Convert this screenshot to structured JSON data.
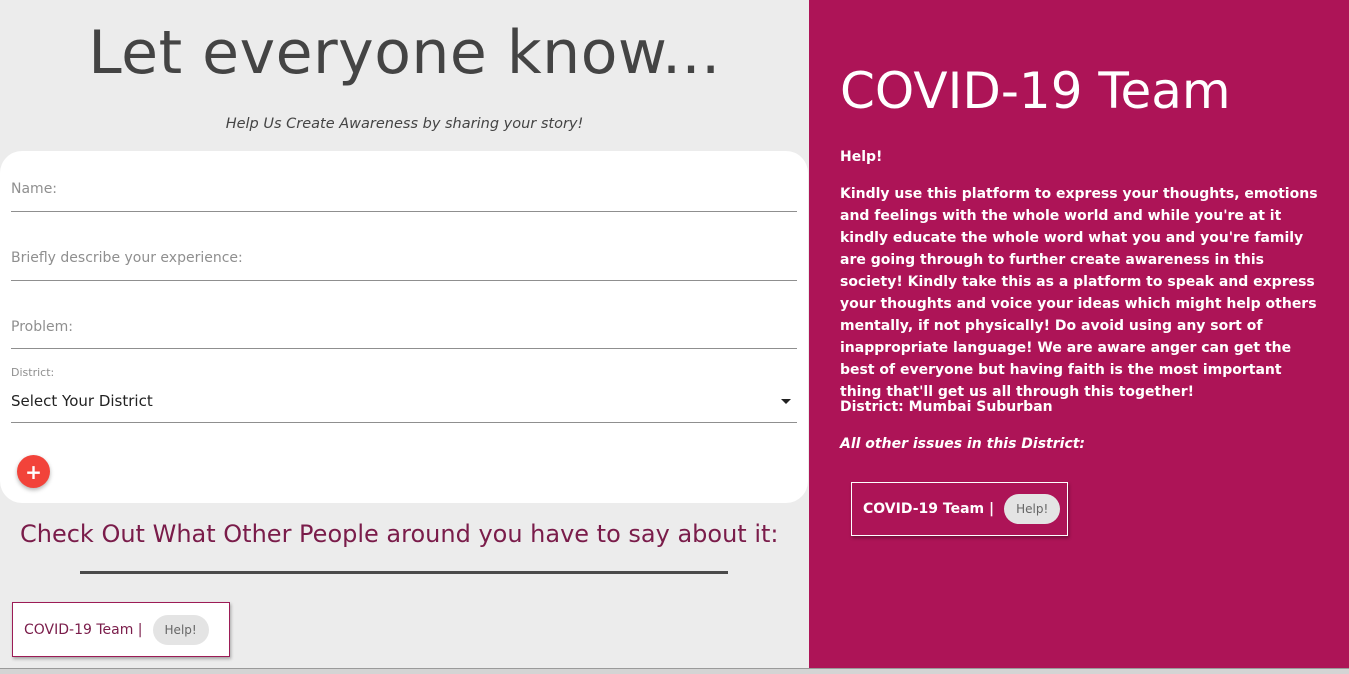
{
  "left": {
    "title": "Let everyone know...",
    "subtitle": "Help Us Create Awareness by sharing your story!",
    "form": {
      "name_label": "Name:",
      "experience_label": "Briefly describe your experience:",
      "problem_label": "Problem:",
      "district_label": "District:",
      "district_selected": "Select Your District",
      "add_button": "+"
    },
    "check_title": "Check Out What Other People around you have to say about it:",
    "cards": [
      {
        "team": "COVID-19 Team |",
        "tag": "Help!"
      }
    ]
  },
  "right": {
    "title": "COVID-19 Team",
    "help_label": "Help!",
    "story": "Kindly use this platform to express your thoughts, emotions and feelings with the whole world and while you're at it kindly educate the whole word what you and you're family are going through to further create awareness in this society! Kindly take this as a platform to speak and express your thoughts and voice your ideas which might help others mentally, if not physically! Do avoid using any sort of inappropriate language! We are aware anger can get the best of everyone but having faith is the most important thing that'll get us all through this together!",
    "district_line": "District: Mumbai Suburban",
    "other_issues": "All other issues in this District:",
    "cards": [
      {
        "team": "COVID-19 Team |",
        "tag": "Help!"
      }
    ]
  },
  "colors": {
    "accent": "#ad1457",
    "add_button": "#f2433a",
    "heading_dark": "#7a1c4a"
  }
}
